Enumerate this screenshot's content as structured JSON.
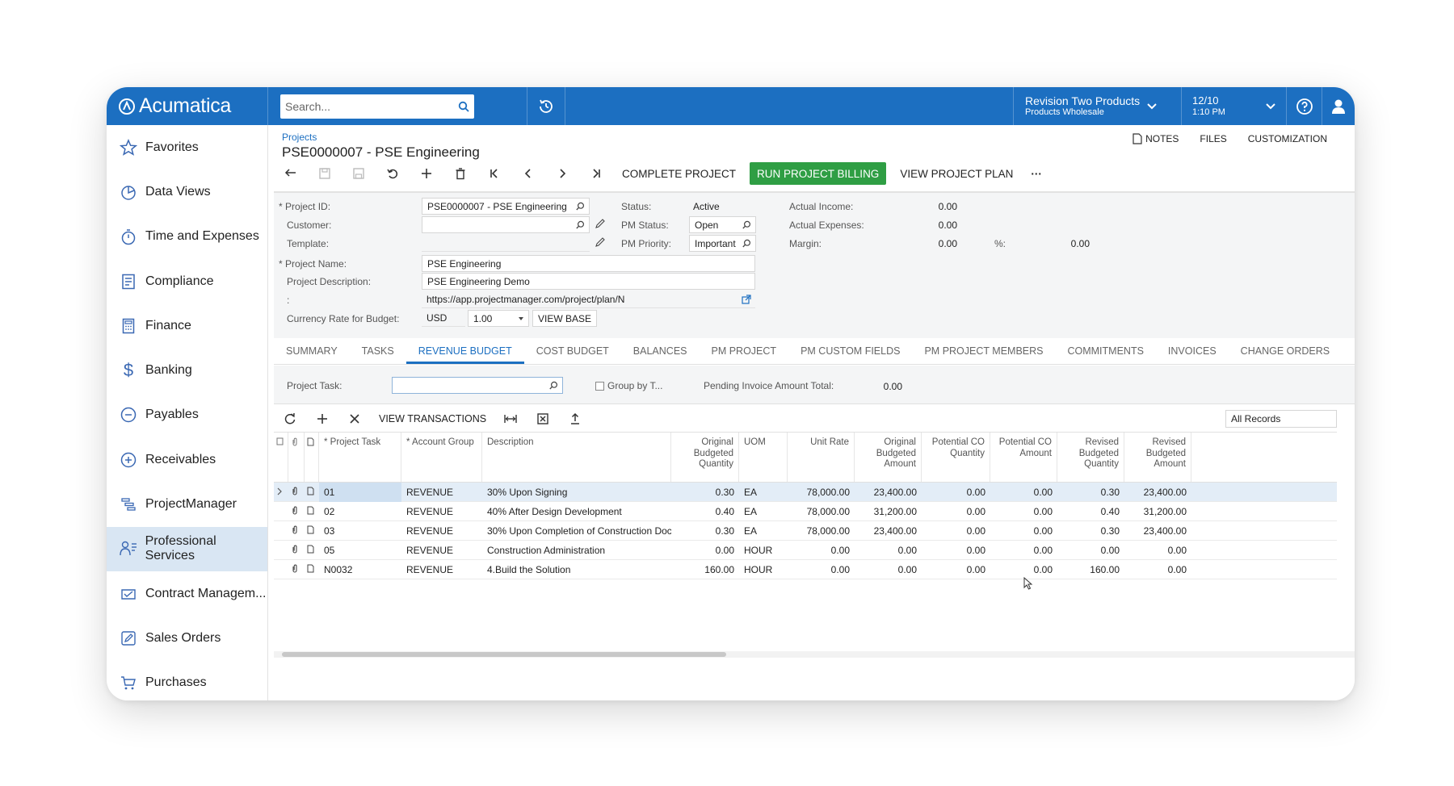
{
  "app": {
    "brand": "Acumatica",
    "search_placeholder": "Search...",
    "tenant_line1": "Revision Two Products",
    "tenant_line2": "Products Wholesale",
    "date": "12/10",
    "time": "1:10 PM",
    "accent_color": "#1c6fc1",
    "primary_button_color": "#2f9e44"
  },
  "sidebar": {
    "items": [
      {
        "label": "Favorites",
        "icon": "star-icon"
      },
      {
        "label": "Data Views",
        "icon": "pie-chart-icon"
      },
      {
        "label": "Time and Expenses",
        "icon": "stopwatch-icon"
      },
      {
        "label": "Compliance",
        "icon": "checklist-icon"
      },
      {
        "label": "Finance",
        "icon": "calculator-icon"
      },
      {
        "label": "Banking",
        "icon": "dollar-icon"
      },
      {
        "label": "Payables",
        "icon": "minus-circle-icon"
      },
      {
        "label": "Receivables",
        "icon": "plus-circle-icon"
      },
      {
        "label": "ProjectManager",
        "icon": "gantt-icon"
      },
      {
        "label": "Professional Services",
        "icon": "people-icon"
      },
      {
        "label": "Contract Managem...",
        "icon": "contract-icon"
      },
      {
        "label": "Sales Orders",
        "icon": "edit-box-icon"
      },
      {
        "label": "Purchases",
        "icon": "cart-icon"
      }
    ],
    "active_index": 9
  },
  "header": {
    "breadcrumb": "Projects",
    "title": "PSE0000007 - PSE Engineering",
    "notes": "NOTES",
    "files": "FILES",
    "customization": "CUSTOMIZATION"
  },
  "toolbar": {
    "complete_project": "COMPLETE PROJECT",
    "run_billing": "RUN PROJECT BILLING",
    "view_plan": "VIEW PROJECT PLAN",
    "more": "···"
  },
  "form": {
    "project_id_label": "Project ID:",
    "project_id_value": "PSE0000007 - PSE Engineering",
    "customer_label": "Customer:",
    "customer_value": "",
    "template_label": "Template:",
    "project_name_label": "Project Name:",
    "project_name_value": "PSE Engineering",
    "project_desc_label": "Project Description:",
    "project_desc_value": "PSE Engineering Demo",
    "url_label": ":",
    "url_value": "https://app.projectmanager.com/project/plan/N",
    "currency_label": "Currency Rate for Budget:",
    "currency_value": "USD",
    "rate_value": "1.00",
    "view_base": "VIEW BASE",
    "status_label": "Status:",
    "status_value": "Active",
    "pm_status_label": "PM Status:",
    "pm_status_value": "Open",
    "pm_priority_label": "PM Priority:",
    "pm_priority_value": "Important",
    "actual_income_label": "Actual Income:",
    "actual_income_value": "0.00",
    "actual_expenses_label": "Actual Expenses:",
    "actual_expenses_value": "0.00",
    "margin_label": "Margin:",
    "margin_value": "0.00",
    "pct_label": "%:",
    "pct_value": "0.00"
  },
  "tabs": [
    "SUMMARY",
    "TASKS",
    "REVENUE BUDGET",
    "COST BUDGET",
    "BALANCES",
    "PM PROJECT",
    "PM CUSTOM FIELDS",
    "PM PROJECT MEMBERS",
    "COMMITMENTS",
    "INVOICES",
    "CHANGE ORDERS"
  ],
  "active_tab_index": 2,
  "filter": {
    "project_task_label": "Project Task:",
    "project_task_value": "",
    "group_by_label": "Group by T...",
    "pending_label": "Pending Invoice Amount Total:",
    "pending_value": "0.00"
  },
  "grid_toolbar": {
    "view_transactions": "VIEW TRANSACTIONS",
    "records_filter": "All Records"
  },
  "grid": {
    "columns": {
      "task": "Project Task",
      "group": "Account Group",
      "desc": "Description",
      "orig_qty": "Original Budgeted Quantity",
      "uom": "UOM",
      "unit_rate": "Unit Rate",
      "orig_amt": "Original Budgeted Amount",
      "pot_qty": "Potential CO Quantity",
      "pot_amt": "Potential CO Amount",
      "rev_qty": "Revised Budgeted Quantity",
      "rev_amt": "Revised Budgeted Amount"
    },
    "rows": [
      {
        "task": "01",
        "group": "REVENUE",
        "desc": "30% Upon Signing",
        "orig_qty": "0.30",
        "uom": "EA",
        "unit_rate": "78,000.00",
        "orig_amt": "23,400.00",
        "pot_qty": "0.00",
        "pot_amt": "0.00",
        "rev_qty": "0.30",
        "rev_amt": "23,400.00"
      },
      {
        "task": "02",
        "group": "REVENUE",
        "desc": "40% After Design Development",
        "orig_qty": "0.40",
        "uom": "EA",
        "unit_rate": "78,000.00",
        "orig_amt": "31,200.00",
        "pot_qty": "0.00",
        "pot_amt": "0.00",
        "rev_qty": "0.40",
        "rev_amt": "31,200.00"
      },
      {
        "task": "03",
        "group": "REVENUE",
        "desc": "30% Upon Completion of Construction Doc...",
        "orig_qty": "0.30",
        "uom": "EA",
        "unit_rate": "78,000.00",
        "orig_amt": "23,400.00",
        "pot_qty": "0.00",
        "pot_amt": "0.00",
        "rev_qty": "0.30",
        "rev_amt": "23,400.00"
      },
      {
        "task": "05",
        "group": "REVENUE",
        "desc": "Construction Administration",
        "orig_qty": "0.00",
        "uom": "HOUR",
        "unit_rate": "0.00",
        "orig_amt": "0.00",
        "pot_qty": "0.00",
        "pot_amt": "0.00",
        "rev_qty": "0.00",
        "rev_amt": "0.00"
      },
      {
        "task": "N0032",
        "group": "REVENUE",
        "desc": "4.Build the Solution",
        "orig_qty": "160.00",
        "uom": "HOUR",
        "unit_rate": "0.00",
        "orig_amt": "0.00",
        "pot_qty": "0.00",
        "pot_amt": "0.00",
        "rev_qty": "160.00",
        "rev_amt": "0.00"
      }
    ]
  }
}
